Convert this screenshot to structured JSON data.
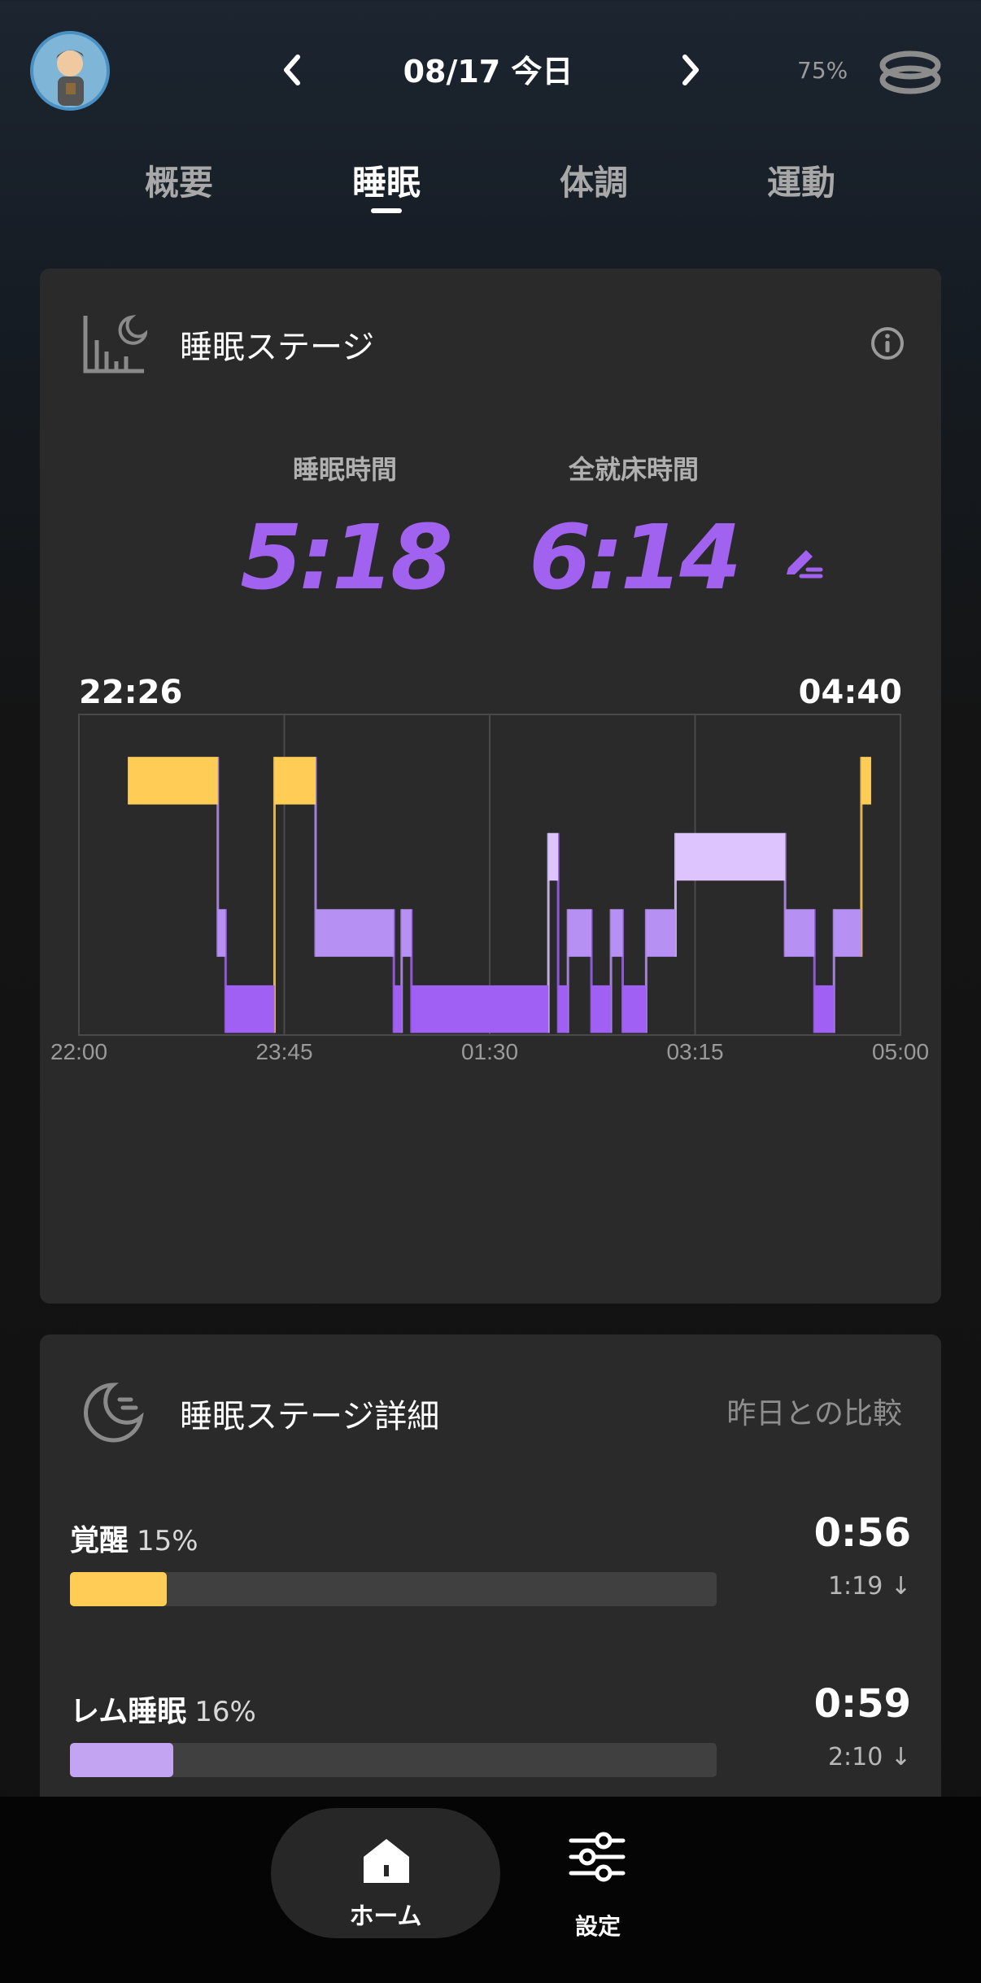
{
  "header": {
    "date_title": "08/17 今日",
    "battery": "75%"
  },
  "tabs": [
    {
      "label": "概要",
      "active": false
    },
    {
      "label": "睡眠",
      "active": true
    },
    {
      "label": "体調",
      "active": false
    },
    {
      "label": "運動",
      "active": false
    }
  ],
  "sleep_stage_card": {
    "title": "睡眠ステージ",
    "sleep_time_label": "睡眠時間",
    "sleep_time_value": "5:18",
    "total_bed_label": "全就床時間",
    "total_bed_value": "6:14",
    "start_time": "22:26",
    "end_time": "04:40"
  },
  "chart_data": {
    "type": "step",
    "x_ticks": [
      "22:00",
      "23:45",
      "01:30",
      "03:15",
      "05:00"
    ],
    "x_range_minutes": [
      0,
      420
    ],
    "levels": [
      "awake",
      "light",
      "rem",
      "deep"
    ],
    "colors": {
      "awake": "#ffcd55",
      "light": "#ddc4ff",
      "rem": "#b690f2",
      "deep": "#a060f4"
    },
    "segments": [
      {
        "start": 25,
        "end": 71,
        "stage": "awake"
      },
      {
        "start": 71,
        "end": 75,
        "stage": "rem"
      },
      {
        "start": 75,
        "end": 100,
        "stage": "deep"
      },
      {
        "start": 100,
        "end": 121,
        "stage": "awake"
      },
      {
        "start": 121,
        "end": 161,
        "stage": "rem"
      },
      {
        "start": 161,
        "end": 165,
        "stage": "deep"
      },
      {
        "start": 165,
        "end": 170,
        "stage": "rem"
      },
      {
        "start": 170,
        "end": 240,
        "stage": "deep"
      },
      {
        "start": 240,
        "end": 245,
        "stage": "light"
      },
      {
        "start": 245,
        "end": 250,
        "stage": "deep"
      },
      {
        "start": 250,
        "end": 262,
        "stage": "rem"
      },
      {
        "start": 262,
        "end": 272,
        "stage": "deep"
      },
      {
        "start": 272,
        "end": 278,
        "stage": "rem"
      },
      {
        "start": 278,
        "end": 290,
        "stage": "deep"
      },
      {
        "start": 290,
        "end": 305,
        "stage": "rem"
      },
      {
        "start": 305,
        "end": 361,
        "stage": "light"
      },
      {
        "start": 361,
        "end": 376,
        "stage": "rem"
      },
      {
        "start": 376,
        "end": 386,
        "stage": "deep"
      },
      {
        "start": 386,
        "end": 400,
        "stage": "rem"
      },
      {
        "start": 400,
        "end": 405,
        "stage": "awake"
      }
    ]
  },
  "detail_card": {
    "title": "睡眠ステージ詳細",
    "compare_label": "昨日との比較",
    "stages": [
      {
        "name": "覚醒",
        "percent": "15%",
        "time": "0:56",
        "delta": "1:19 ↓",
        "fill": 0.15,
        "color": "#ffcd55"
      },
      {
        "name": "レム睡眠",
        "percent": "16%",
        "time": "0:59",
        "delta": "2:10 ↓",
        "fill": 0.16,
        "color": "#c3a4f2"
      }
    ]
  },
  "bottom_nav": {
    "home_label": "ホーム",
    "settings_label": "設定"
  }
}
